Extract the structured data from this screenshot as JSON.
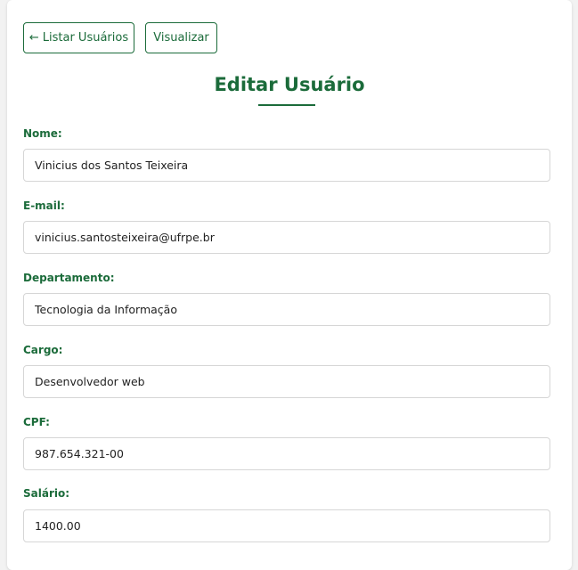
{
  "nav": {
    "list_users_arrow": "←",
    "list_users_label": "Listar Usuários",
    "view_label": "Visualizar"
  },
  "page": {
    "title": "Editar Usuário"
  },
  "form": {
    "name_label": "Nome:",
    "name_value": "Vinicius dos Santos Teixeira",
    "email_label": "E-mail:",
    "email_value": "vinicius.santosteixeira@ufrpe.br",
    "department_label": "Departamento:",
    "department_value": "Tecnologia da Informação",
    "role_label": "Cargo:",
    "role_value": "Desenvolvedor web",
    "cpf_label": "CPF:",
    "cpf_value": "987.654.321-00",
    "salary_label": "Salário:",
    "salary_value": "1400.00"
  },
  "colors": {
    "accent": "#1b6b3a",
    "input_border": "#d6d6d6",
    "background": "#f2f2f2"
  }
}
